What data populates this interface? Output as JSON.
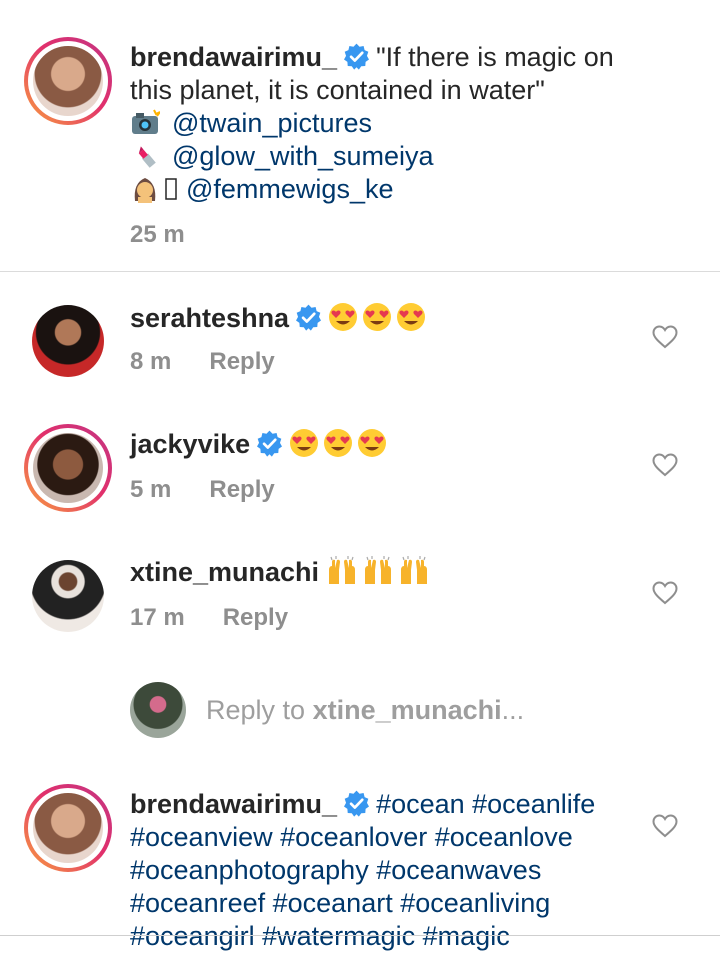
{
  "caption": {
    "username": "brendawairimu_",
    "quote": "\"If there is magic on",
    "quote_line2": "this planet, it is contained in water\"",
    "credits": [
      {
        "icon": "camera-flash-icon",
        "handle": "@twain_pictures"
      },
      {
        "icon": "lipstick-icon",
        "handle": "@glow_with_sumeiya"
      },
      {
        "icon": "woman-icon",
        "handle": "@femmewigs_ke"
      }
    ],
    "time": "25 m"
  },
  "comments": [
    {
      "username": "serahteshna",
      "verified": true,
      "text_icons": [
        "heart-eyes-icon",
        "heart-eyes-icon",
        "heart-eyes-icon"
      ],
      "time": "8 m",
      "reply": "Reply"
    },
    {
      "username": "jackyvike",
      "verified": true,
      "text_icons": [
        "heart-eyes-icon",
        "heart-eyes-icon",
        "heart-eyes-icon"
      ],
      "time": "5 m",
      "reply": "Reply"
    },
    {
      "username": "xtine_munachi",
      "verified": false,
      "text_icons": [
        "raising-hands-icon",
        "raising-hands-icon",
        "raising-hands-icon"
      ],
      "time": "17 m",
      "reply": "Reply"
    }
  ],
  "reply_box": {
    "prefix": "Reply to ",
    "username": "xtine_munachi",
    "suffix": "..."
  },
  "last_comment": {
    "username": "brendawairimu_",
    "line1": "#ocean #oceanlife",
    "line2": "#oceanview #oceanlover #oceanlove",
    "line3": "#oceanphotography #oceanwaves",
    "line4": "#oceanreef #oceanart #oceanliving",
    "line5": "#oceangirl #watermagic #magic"
  },
  "colors": {
    "link": "#00376b",
    "meta": "#8e8e8e",
    "verified": "#3897f0",
    "divider": "#dbdbdb"
  }
}
